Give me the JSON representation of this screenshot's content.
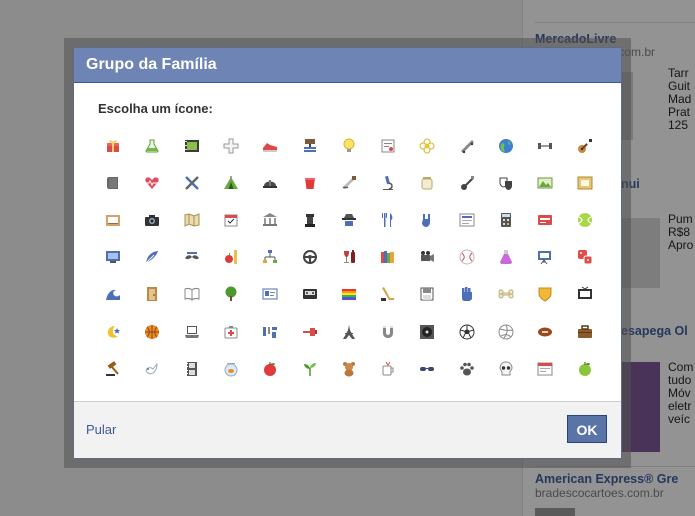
{
  "dialog": {
    "title": "Grupo da Família",
    "prompt": "Escolha um ícone:",
    "skip_label": "Pular",
    "ok_label": "OK",
    "icons": [
      "gift",
      "flask",
      "film-frame",
      "plus-cross",
      "sneaker",
      "paint-roller",
      "lightbulb",
      "certificate",
      "flower",
      "skateboard",
      "globe",
      "dumbbell",
      "guitar",
      "book-dark",
      "heartbeat",
      "crossed-tools",
      "tent",
      "hard-hat",
      "cup",
      "saw",
      "microscope",
      "jar",
      "guitar-head",
      "masks",
      "mountain-photo",
      "picture-frame",
      "inbox",
      "camera",
      "map",
      "calendar",
      "bank",
      "chess-rook",
      "spy",
      "knife-fork",
      "rock-hand",
      "newspaper",
      "calculator",
      "id-card",
      "tennis-ball",
      "monitor",
      "feather",
      "mustache",
      "apple-ruler",
      "sitemap",
      "steering-wheel",
      "wine",
      "books",
      "projector",
      "baseball",
      "potion",
      "easel",
      "dice",
      "wave",
      "door",
      "open-book",
      "tree",
      "contact-card",
      "cassette",
      "rainbow",
      "hockey",
      "floppy",
      "fist",
      "bone",
      "shield",
      "television",
      "moon-star",
      "basketball",
      "laptop",
      "first-aid",
      "music",
      "pushpin",
      "eiffel-tower",
      "magnet",
      "vinyl",
      "soccer-ball",
      "volleyball",
      "football",
      "briefcase",
      "gavel",
      "dove",
      "film-strip",
      "fishbowl",
      "apple-red",
      "sprout",
      "teddy-bear",
      "mug",
      "sunglasses",
      "paw",
      "skull",
      "browser-window",
      "apple-green"
    ]
  },
  "background": {
    "ad1": {
      "title": "MercadoLivre",
      "domain": ".com.br",
      "lines": [
        "Tarr",
        "Guit",
        "Mad",
        "Prat",
        "125"
      ]
    },
    "ad2": {
      "title": "nui",
      "lines": [
        "Pum",
        "R$8",
        "Apro"
      ]
    },
    "ad3": {
      "title": "esapega Ol",
      "lines": [
        "Com",
        "tudo",
        "Móv",
        "eletr",
        "veíc"
      ]
    },
    "ad4": {
      "title": "American Express® Gre",
      "domain": "bradescocartoes.com.br"
    }
  },
  "colors": {
    "header": "#6d84b4",
    "button": "#5b74a8",
    "link": "#3b5998"
  }
}
